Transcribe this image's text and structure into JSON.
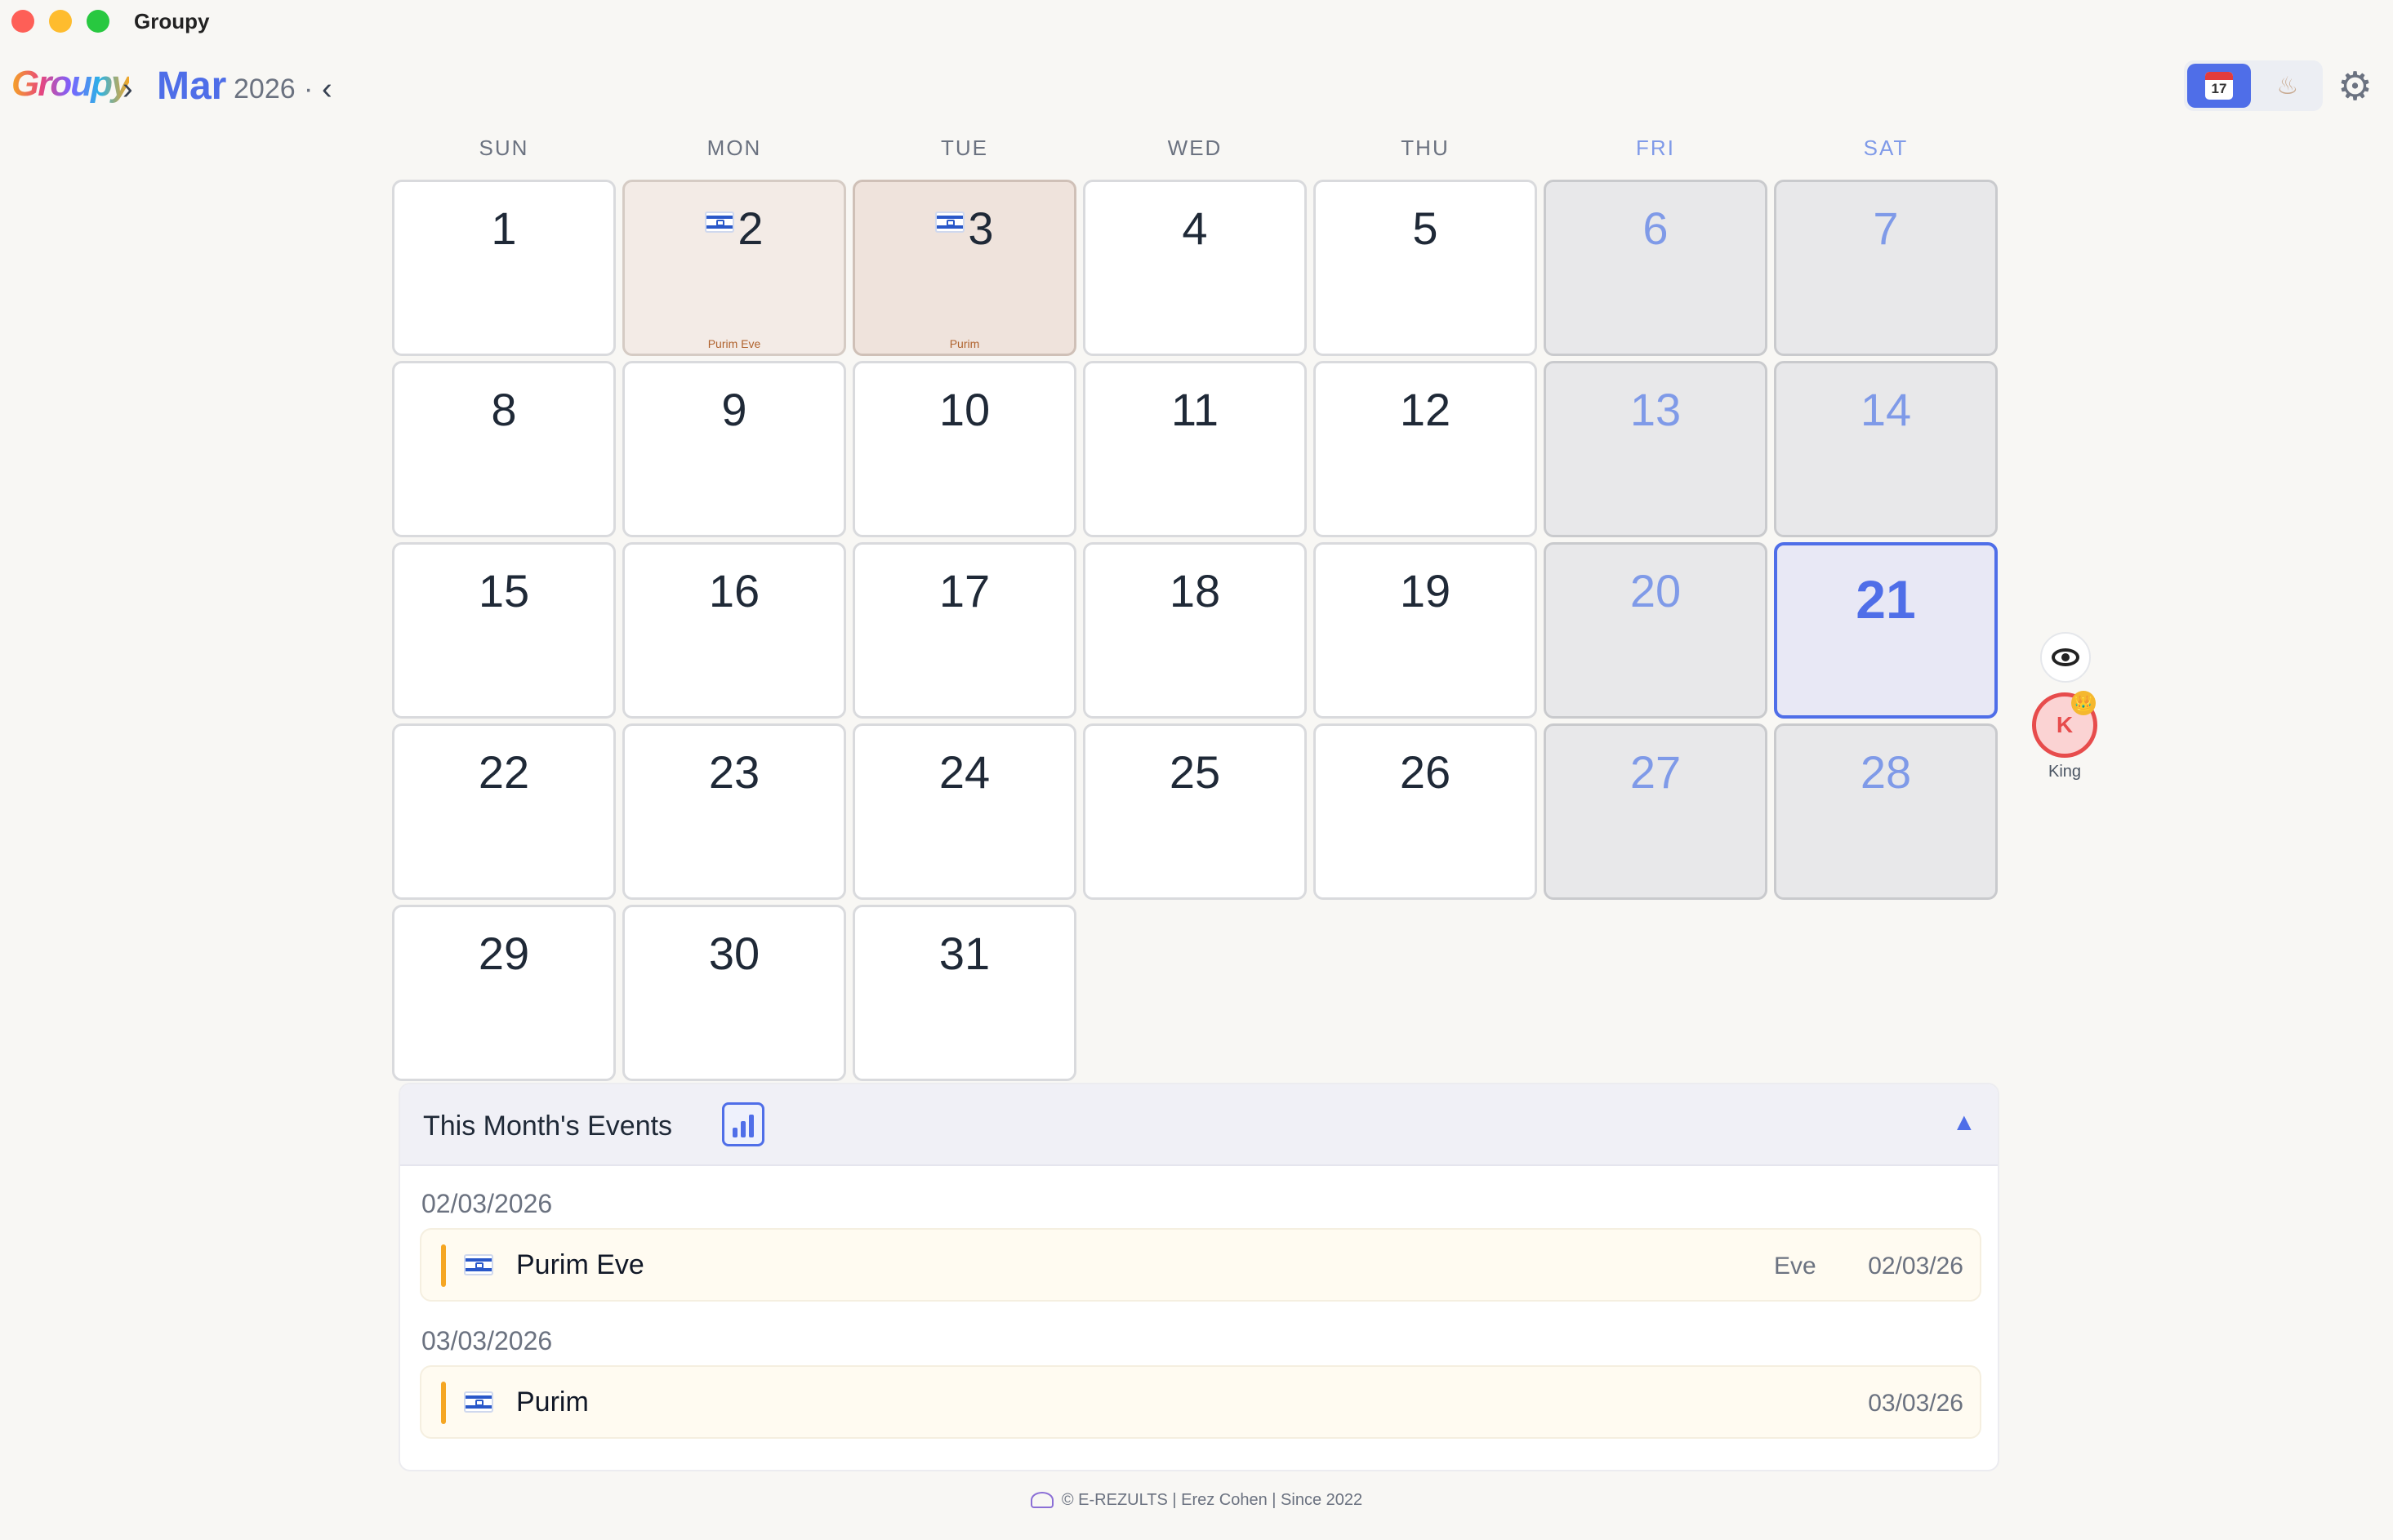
{
  "app": {
    "title": "Groupy",
    "logo_text": "Groupy"
  },
  "header": {
    "next_icon": "›",
    "prev_icon": "‹",
    "month": "Mar",
    "year": "2026",
    "year_suffix": "·",
    "calendar_icon_day": "17",
    "cake_icon": "cake-icon",
    "settings_icon": "⚙"
  },
  "weekdays": [
    "SUN",
    "MON",
    "TUE",
    "WED",
    "THU",
    "FRI",
    "SAT"
  ],
  "calendar": {
    "today": "21",
    "weeks": [
      [
        "1",
        "2",
        "3",
        "4",
        "5",
        "6",
        "7"
      ],
      [
        "8",
        "9",
        "10",
        "11",
        "12",
        "13",
        "14"
      ],
      [
        "15",
        "16",
        "17",
        "18",
        "19",
        "20",
        "21"
      ],
      [
        "22",
        "23",
        "24",
        "25",
        "26",
        "27",
        "28"
      ],
      [
        "29",
        "30",
        "31",
        "",
        "",
        "",
        ""
      ]
    ],
    "holidays": {
      "2": "Purim Eve",
      "3": "Purim"
    }
  },
  "side": {
    "visibility_icon": "eye-icon",
    "user_initial": "K",
    "user_badge": "👑",
    "user_name": "King"
  },
  "events": {
    "title": "This Month's Events",
    "collapse_icon": "▲",
    "groups": [
      {
        "date": "02/03/2026",
        "name": "Purim Eve",
        "type": "Eve",
        "short_date": "02/03/26"
      },
      {
        "date": "03/03/2026",
        "name": "Purim",
        "type": "",
        "short_date": "03/03/26"
      }
    ]
  },
  "footer": {
    "text": "© E-REZULTS | Erez Cohen | Since 2022"
  },
  "colors": {
    "accent": "#4f6ee8",
    "weekend": "#7f9ae8",
    "holiday_text": "#b0632e",
    "event_accent": "#f5a623"
  }
}
